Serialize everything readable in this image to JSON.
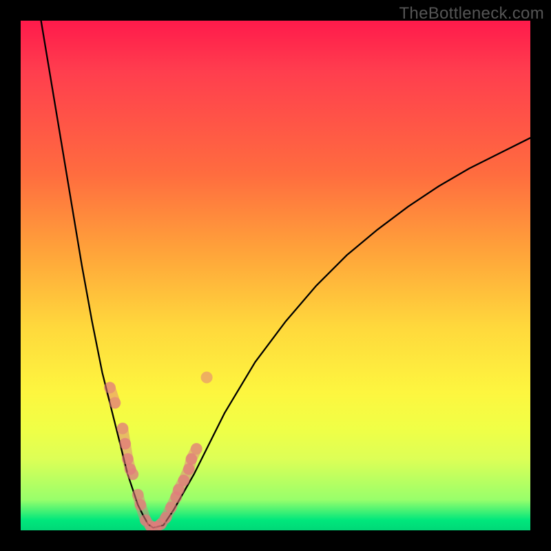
{
  "watermark": "TheBottleneck.com",
  "chart_data": {
    "type": "line",
    "title": "",
    "xlabel": "",
    "ylabel": "",
    "xlim": [
      0,
      100
    ],
    "ylim": [
      0,
      100
    ],
    "grid": false,
    "legend": false,
    "series": [
      {
        "name": "curve",
        "x": [
          4,
          6,
          8,
          10,
          12,
          14,
          16,
          17,
          18,
          19,
          20,
          21,
          22,
          23,
          24,
          25,
          26,
          28,
          30,
          34,
          40,
          46,
          52,
          58,
          64,
          70,
          76,
          82,
          88,
          94,
          100
        ],
        "y": [
          100,
          88,
          76,
          64,
          52,
          41,
          31,
          27,
          23,
          19,
          15,
          11,
          8,
          5,
          3,
          1.2,
          0.5,
          1,
          4,
          11,
          23,
          33,
          41,
          48,
          54,
          59,
          63.5,
          67.5,
          71,
          74,
          77
        ]
      }
    ],
    "highlight_points": {
      "name": "sample-dots",
      "points": [
        {
          "x": 17.5,
          "y": 28
        },
        {
          "x": 18.5,
          "y": 25
        },
        {
          "x": 20.0,
          "y": 20
        },
        {
          "x": 20.5,
          "y": 17
        },
        {
          "x": 21.0,
          "y": 14
        },
        {
          "x": 21.5,
          "y": 12
        },
        {
          "x": 22.0,
          "y": 11
        },
        {
          "x": 23.0,
          "y": 7
        },
        {
          "x": 23.5,
          "y": 5
        },
        {
          "x": 24.5,
          "y": 2
        },
        {
          "x": 25.5,
          "y": 0.8
        },
        {
          "x": 26.5,
          "y": 0.6
        },
        {
          "x": 27.5,
          "y": 1.2
        },
        {
          "x": 28.5,
          "y": 2.5
        },
        {
          "x": 29.5,
          "y": 4.5
        },
        {
          "x": 30.5,
          "y": 6.5
        },
        {
          "x": 31.0,
          "y": 8.0
        },
        {
          "x": 32.0,
          "y": 9.8
        },
        {
          "x": 33.0,
          "y": 12.0
        },
        {
          "x": 33.5,
          "y": 14.0
        },
        {
          "x": 34.5,
          "y": 16.0
        },
        {
          "x": 36.5,
          "y": 30.0
        }
      ]
    }
  }
}
